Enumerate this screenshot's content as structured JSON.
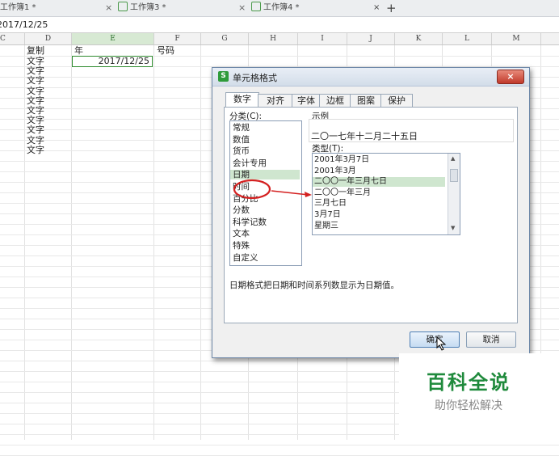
{
  "tabs": [
    {
      "label": "工作簿1 *",
      "close": "×"
    },
    {
      "label": "工作簿3 *",
      "close": "×"
    },
    {
      "label": "工作簿4 *",
      "close": "×"
    }
  ],
  "new_tab": "+",
  "formula_bar": {
    "value": "2017/12/25"
  },
  "columns": [
    "C",
    "D",
    "E",
    "F",
    "G",
    "H",
    "I",
    "J",
    "K",
    "L",
    "M"
  ],
  "cells": {
    "d_header": "复制",
    "e_header": "年",
    "f_header": "号码",
    "e_value": "2017/12/25",
    "d_values": [
      "文字",
      "文字",
      "文字",
      "文字",
      "文字",
      "文字",
      "文字",
      "文字",
      "文字",
      "文字"
    ]
  },
  "dialog": {
    "title": "单元格格式",
    "close": "×",
    "tabs": [
      "数字",
      "对齐",
      "字体",
      "边框",
      "图案",
      "保护"
    ],
    "category_label": "分类(C):",
    "categories": [
      "常规",
      "数值",
      "货币",
      "会计专用",
      "日期",
      "时间",
      "百分比",
      "分数",
      "科学记数",
      "文本",
      "特殊",
      "自定义"
    ],
    "selected_category": 4,
    "sample_label": "示例",
    "sample_value": "二〇一七年十二月二十五日",
    "type_label": "类型(T):",
    "types": [
      "2001年3月7日",
      "2001年3月",
      "二〇〇一年三月七日",
      "二〇〇一年三月",
      "三月七日",
      "3月7日",
      "星期三"
    ],
    "selected_type": 2,
    "description": "日期格式把日期和时间系列数显示为日期值。",
    "ok": "确定",
    "cancel": "取消"
  },
  "watermark": {
    "title": "百科全说",
    "subtitle": "助你轻松解决"
  },
  "colors": {
    "accent_green": "#1f8a3c",
    "selection": "#cfe6cf",
    "annotation_red": "#d42020"
  }
}
